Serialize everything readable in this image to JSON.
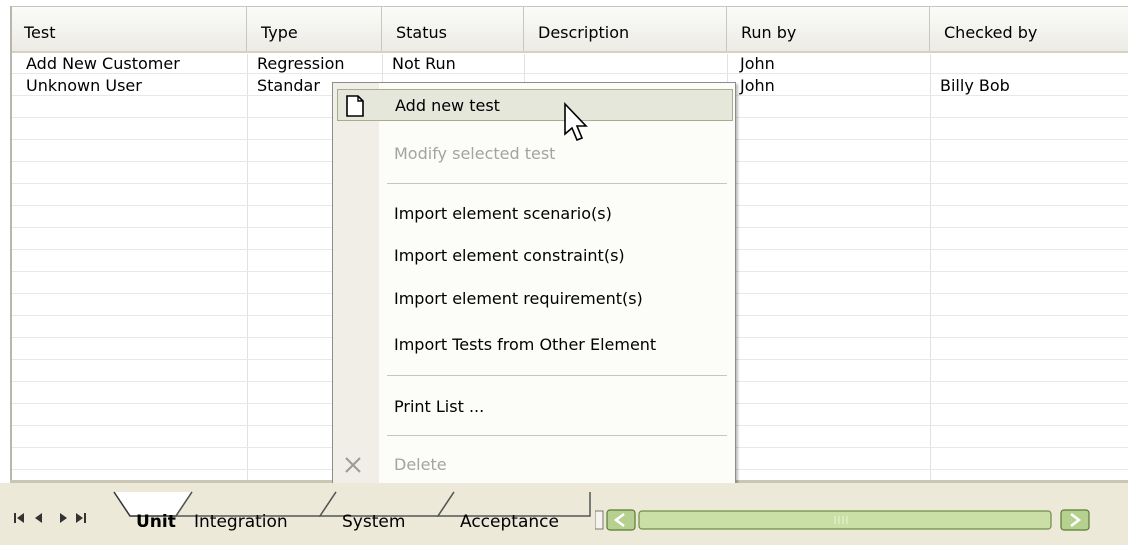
{
  "columns": [
    "Test",
    "Type",
    "Status",
    "Description",
    "Run by",
    "Checked by"
  ],
  "rows": [
    {
      "test": "Add New Customer",
      "type": "Regression",
      "status": "Not Run",
      "description": "",
      "run_by": "John",
      "checked_by": ""
    },
    {
      "test": "Unknown User",
      "type": "Standar",
      "status": "",
      "description": "",
      "run_by": "John",
      "checked_by": "Billy Bob"
    }
  ],
  "context_menu": {
    "items": [
      {
        "label": "Add new test",
        "state": "highlighted",
        "icon": "new-document-icon"
      },
      {
        "label": "Modify selected test",
        "state": "disabled"
      },
      {
        "label": "Import element scenario(s)",
        "state": "enabled"
      },
      {
        "label": "Import element constraint(s)",
        "state": "enabled"
      },
      {
        "label": "Import element requirement(s)",
        "state": "enabled"
      },
      {
        "label": "Import Tests from Other Element",
        "state": "enabled"
      },
      {
        "label": "Print List ...",
        "state": "enabled"
      },
      {
        "label": "Delete",
        "state": "disabled",
        "icon": "delete-x-icon"
      }
    ]
  },
  "tabs": {
    "nav": [
      "first-icon",
      "prev-icon",
      "next-icon",
      "last-icon"
    ],
    "items": [
      "Unit",
      "Integration",
      "System",
      "Acceptance"
    ],
    "active": "Unit"
  },
  "colors": {
    "header_bg": "#ecebe5",
    "menu_highlight": "#e4e7da",
    "menu_highlight_border": "#a6ad8a",
    "scroll_green": "#b6d18f"
  }
}
